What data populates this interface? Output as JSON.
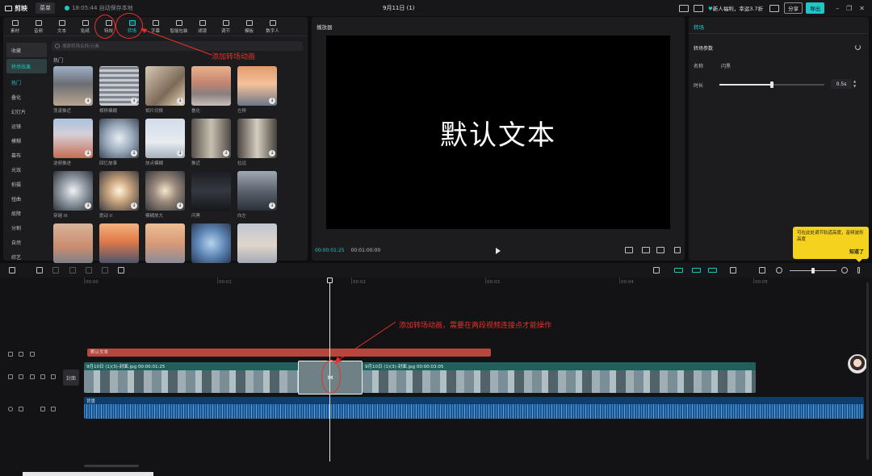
{
  "topbar": {
    "app_name": "剪映",
    "menu_label": "菜单",
    "autosave": "18:05:44 自动保存本地",
    "title": "9月11日 (1)",
    "promo": "新人福利，幸运3.7折",
    "share": "分享",
    "export": "导出"
  },
  "media": {
    "tabs": [
      {
        "label": "素材"
      },
      {
        "label": "音频"
      },
      {
        "label": "文本"
      },
      {
        "label": "贴纸"
      },
      {
        "label": "特效"
      },
      {
        "label": "转场"
      },
      {
        "label": "字幕"
      },
      {
        "label": "智能包装"
      },
      {
        "label": "滤镜"
      },
      {
        "label": "调节"
      },
      {
        "label": "模板"
      },
      {
        "label": "数字人"
      }
    ],
    "categories": [
      "收藏",
      "转场效果",
      "热门",
      "叠化",
      "幻灯片",
      "运镜",
      "模糊",
      "幕布",
      "光效",
      "拍摄",
      "扭曲",
      "故障",
      "分割",
      "自然",
      "综艺"
    ],
    "search_placeholder": "搜索转场名称/元素",
    "section_title": "热门",
    "items": [
      {
        "name": "荡漾推近"
      },
      {
        "name": "横移模糊"
      },
      {
        "name": "相片切换"
      },
      {
        "name": "叠化"
      },
      {
        "name": "左移"
      },
      {
        "name": "逆频推进"
      },
      {
        "name": "回忆故事"
      },
      {
        "name": "放点模糊"
      },
      {
        "name": "推近"
      },
      {
        "name": "拉远"
      },
      {
        "name": "穿越 III"
      },
      {
        "name": "震动 II"
      },
      {
        "name": "模糊放大"
      },
      {
        "name": "闪黑"
      },
      {
        "name": "向左"
      },
      {
        "name": ""
      },
      {
        "name": ""
      },
      {
        "name": ""
      },
      {
        "name": ""
      },
      {
        "name": ""
      }
    ]
  },
  "player": {
    "title": "播放器",
    "video_text": "默认文本",
    "timecode_current": "00:00:01:25",
    "timecode_total": "00:01:00:00"
  },
  "props": {
    "title": "转场",
    "section": "转场参数",
    "name_label": "名称",
    "name_value": "闪黑",
    "duration_label": "时长",
    "duration_value": "0.5s",
    "duration_fraction": 0.5
  },
  "tooltip": {
    "text": "可在此处调节轨道高度，音频波形高度",
    "ok": "知道了"
  },
  "annotations": {
    "top": "添加转场动画",
    "timeline": "添加转场动画，需要在两段视频连接点才能操作"
  },
  "timeline": {
    "ruler": [
      "00:00",
      "00:01",
      "00:02",
      "00:03",
      "00:04",
      "00:05"
    ],
    "cover_label": "封面",
    "text_clip": "默认文本",
    "video_clip_1": "9月10日 (1)(3)-封面.jpg  00:00:01:25",
    "video_clip_2": "9月10日 (1)(3)-封面.jpg  00:00:03:05",
    "audio_label": "背景"
  },
  "colors": {
    "accent": "#20c5c5",
    "annotation": "#e8302a",
    "text_clip": "#b5473d",
    "tooltip": "#f5d21e"
  }
}
